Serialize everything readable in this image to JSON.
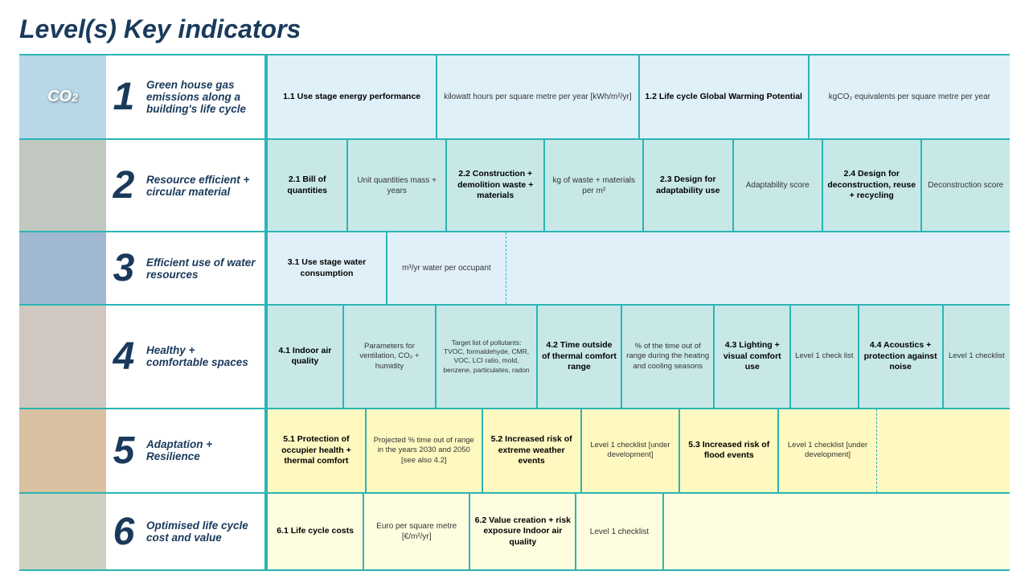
{
  "title": "Level(s) Key indicators",
  "rows": [
    {
      "id": "row-1",
      "number": "1",
      "label": "Green house gas emissions along a building's life cycle",
      "cells": [
        {
          "id": "1-1-label",
          "text": "1.1 Use stage energy performance",
          "type": "label",
          "flex": 1
        },
        {
          "id": "1-1-indicator",
          "text": "kilowatt hours per square metre per year [kWh/m²/yr]",
          "type": "indicator",
          "flex": 1.2
        },
        {
          "id": "1-2-label",
          "text": "1.2 Life cycle Global Warming Potential",
          "type": "label",
          "flex": 1
        },
        {
          "id": "1-2-indicator",
          "text": "kgCO₂ equivalents per square metre per year",
          "type": "indicator",
          "flex": 1.2
        }
      ]
    },
    {
      "id": "row-2",
      "number": "2",
      "label": "Resource efficient + circular material",
      "cells": [
        {
          "id": "2-1-label",
          "text": "2.1 Bill of quantities",
          "type": "label",
          "flex": 0.8
        },
        {
          "id": "2-1-indicator",
          "text": "Unit quantities mass + years",
          "type": "indicator",
          "flex": 1
        },
        {
          "id": "2-2-label",
          "text": "2.2 Construction + demolition waste + materials",
          "type": "label",
          "flex": 1
        },
        {
          "id": "2-2-indicator",
          "text": "kg of waste + materials per m²",
          "type": "indicator",
          "flex": 1
        },
        {
          "id": "2-3-label",
          "text": "2.3 Design for adaptability use",
          "type": "label",
          "flex": 0.9
        },
        {
          "id": "2-3-indicator",
          "text": "Adaptability score",
          "type": "indicator",
          "flex": 0.9
        },
        {
          "id": "2-4-label",
          "text": "2.4 Design for deconstruction, reuse + recycling",
          "type": "label",
          "flex": 1
        },
        {
          "id": "2-4-indicator",
          "text": "Deconstruction score",
          "type": "indicator",
          "flex": 0.9
        }
      ]
    },
    {
      "id": "row-3",
      "number": "3",
      "label": "Efficient use of water resources",
      "cells": [
        {
          "id": "3-1-label",
          "text": "3.1 Use stage water consumption",
          "type": "label",
          "flex": 1
        },
        {
          "id": "3-1-indicator",
          "text": "m³/yr water per occupant",
          "type": "indicator",
          "flex": 1
        }
      ]
    },
    {
      "id": "row-4",
      "number": "4",
      "label": "Healthy + comfortable spaces",
      "cells": [
        {
          "id": "4-1-label",
          "text": "4.1 Indoor air quality",
          "type": "label",
          "flex": 0.8
        },
        {
          "id": "4-1-indicator",
          "text": "Parameters for ventilation, CO₂ + humidity",
          "type": "indicator",
          "flex": 1
        },
        {
          "id": "4-1-indicator2",
          "text": "Target list of pollutants: TVOC, formaldehyde, CMR, VOC, LCI ratio, mold, benzene, particulates, radon",
          "type": "indicator-small",
          "flex": 1.1
        },
        {
          "id": "4-2-label",
          "text": "4.2 Time outside of thermal comfort range",
          "type": "label",
          "flex": 0.9
        },
        {
          "id": "4-2-indicator",
          "text": "% of the time out of range during the heating and cooling seasons",
          "type": "indicator",
          "flex": 1
        },
        {
          "id": "4-3-label",
          "text": "4.3 Lighting + visual comfort use",
          "type": "label",
          "flex": 0.8
        },
        {
          "id": "4-3-indicator",
          "text": "Level 1 check list",
          "type": "indicator",
          "flex": 0.7
        },
        {
          "id": "4-4-label",
          "text": "4.4 Acoustics + protection against noise",
          "type": "label",
          "flex": 0.9
        },
        {
          "id": "4-4-indicator",
          "text": "Level 1 checklist",
          "type": "indicator",
          "flex": 0.7
        }
      ]
    },
    {
      "id": "row-5",
      "number": "5",
      "label": "Adaptation + Resilience",
      "cells": [
        {
          "id": "5-1-label",
          "text": "5.1 Protection of occupier health + thermal comfort",
          "type": "label",
          "flex": 1
        },
        {
          "id": "5-1-indicator",
          "text": "Projected % time out of range in the years 2030 and 2050 [see also 4.2]",
          "type": "indicator",
          "flex": 1.2
        },
        {
          "id": "5-2-label",
          "text": "5.2 Increased risk of extreme weather events",
          "type": "label",
          "flex": 1
        },
        {
          "id": "5-2-indicator",
          "text": "Level 1 checklist [under development]",
          "type": "indicator",
          "flex": 1
        },
        {
          "id": "5-3-label",
          "text": "5.3 Increased risk of flood events",
          "type": "label",
          "flex": 1
        },
        {
          "id": "5-3-indicator",
          "text": "Level 1 checklist [under development]",
          "type": "indicator",
          "flex": 1
        }
      ]
    },
    {
      "id": "row-6",
      "number": "6",
      "label": "Optimised life cycle cost and value",
      "cells": [
        {
          "id": "6-1-label",
          "text": "6.1 Life cycle costs",
          "type": "label",
          "flex": 0.9
        },
        {
          "id": "6-1-indicator",
          "text": "Euro per square metre [€/m²/yr]",
          "type": "indicator",
          "flex": 1
        },
        {
          "id": "6-2-label",
          "text": "6.2 Value creation + risk exposure Indoor air quality",
          "type": "label",
          "flex": 1
        },
        {
          "id": "6-2-indicator",
          "text": "Level 1 checklist",
          "type": "indicator",
          "flex": 0.8
        }
      ]
    }
  ]
}
